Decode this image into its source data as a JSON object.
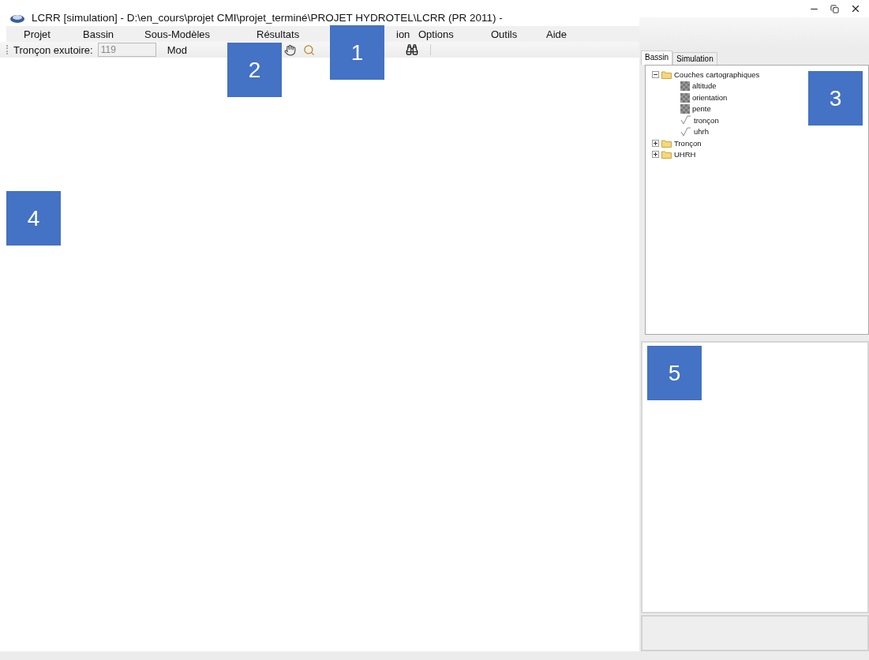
{
  "window": {
    "title": "LCRR [simulation] - D:\\en_cours\\projet CMI\\projet_terminé\\PROJET HYDROTEL\\LCRR (PR 2011) -"
  },
  "menu": [
    "Projet",
    "Bassin",
    "Sous-Modèles",
    "Résultats",
    "ion",
    "Options",
    "Outils",
    "Aide"
  ],
  "toolbar": {
    "outlet_label": "Tronçon exutoire:",
    "outlet_value": "119",
    "mode_label": "Mod"
  },
  "tabs": [
    {
      "label": "Bassin",
      "selected": true
    },
    {
      "label": "Simulation",
      "selected": false
    }
  ],
  "tree": [
    {
      "label": "Couches cartographiques",
      "kind": "folder",
      "expanded": true,
      "children": [
        {
          "label": "altitude",
          "kind": "raster"
        },
        {
          "label": "orientation",
          "kind": "raster"
        },
        {
          "label": "pente",
          "kind": "raster"
        },
        {
          "label": "tronçon",
          "kind": "line"
        },
        {
          "label": "uhrh",
          "kind": "line"
        }
      ]
    },
    {
      "label": "Tronçon",
      "kind": "folder",
      "expanded": false
    },
    {
      "label": "UHRH",
      "kind": "folder",
      "expanded": false
    }
  ],
  "callouts": [
    "1",
    "2",
    "3",
    "4",
    "5"
  ]
}
